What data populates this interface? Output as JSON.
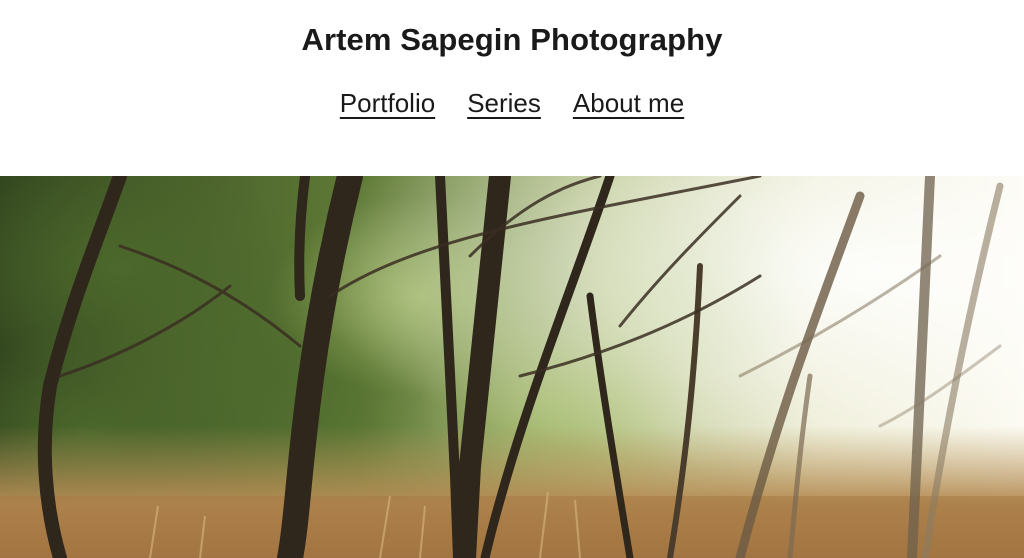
{
  "site": {
    "title": "Artem Sapegin Photography"
  },
  "nav": {
    "items": [
      {
        "label": "Portfolio"
      },
      {
        "label": "Series"
      },
      {
        "label": "About me"
      }
    ]
  },
  "hero": {
    "subject": "forest-photo",
    "colors": {
      "foliage_dark": "#3f5a2a",
      "foliage_light": "#9fb56a",
      "light_haze": "#f6f3e6",
      "ground": "#c8a26a",
      "trunk": "#3a2e22"
    }
  }
}
